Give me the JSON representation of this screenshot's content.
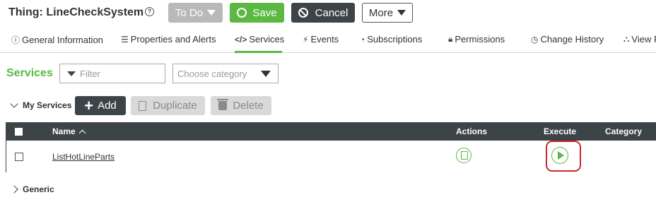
{
  "header": {
    "title": "Thing: LineCheckSystem",
    "help_icon": "question-circle-icon",
    "state_label": "To Do",
    "save_label": "Save",
    "cancel_label": "Cancel",
    "more_label": "More"
  },
  "tabs": [
    {
      "label": "General Information",
      "icon": "info-circle-icon"
    },
    {
      "label": "Properties and Alerts",
      "icon": "list-icon"
    },
    {
      "label": "Services",
      "icon": "code-icon",
      "active": true
    },
    {
      "label": "Events",
      "icon": "bolt-icon"
    },
    {
      "label": "Subscriptions",
      "icon": "rss-icon"
    },
    {
      "label": "Permissions",
      "icon": "lock-icon"
    },
    {
      "label": "Change History",
      "icon": "clock-icon"
    },
    {
      "label": "View R",
      "icon": "sitemap-icon"
    }
  ],
  "services": {
    "title": "Services",
    "filter_placeholder": "Filter",
    "category_placeholder": "Choose category",
    "my_services_label": "My Services",
    "add_label": "Add",
    "duplicate_label": "Duplicate",
    "delete_label": "Delete",
    "generic_label": "Generic"
  },
  "table": {
    "columns": {
      "name": "Name",
      "actions": "Actions",
      "execute": "Execute",
      "category": "Category"
    },
    "rows": [
      {
        "name": "ListHotLineParts",
        "category": ""
      }
    ]
  },
  "colors": {
    "accent_green": "#5bb843",
    "dark": "#3d4447",
    "highlight_red": "#cc2929"
  }
}
